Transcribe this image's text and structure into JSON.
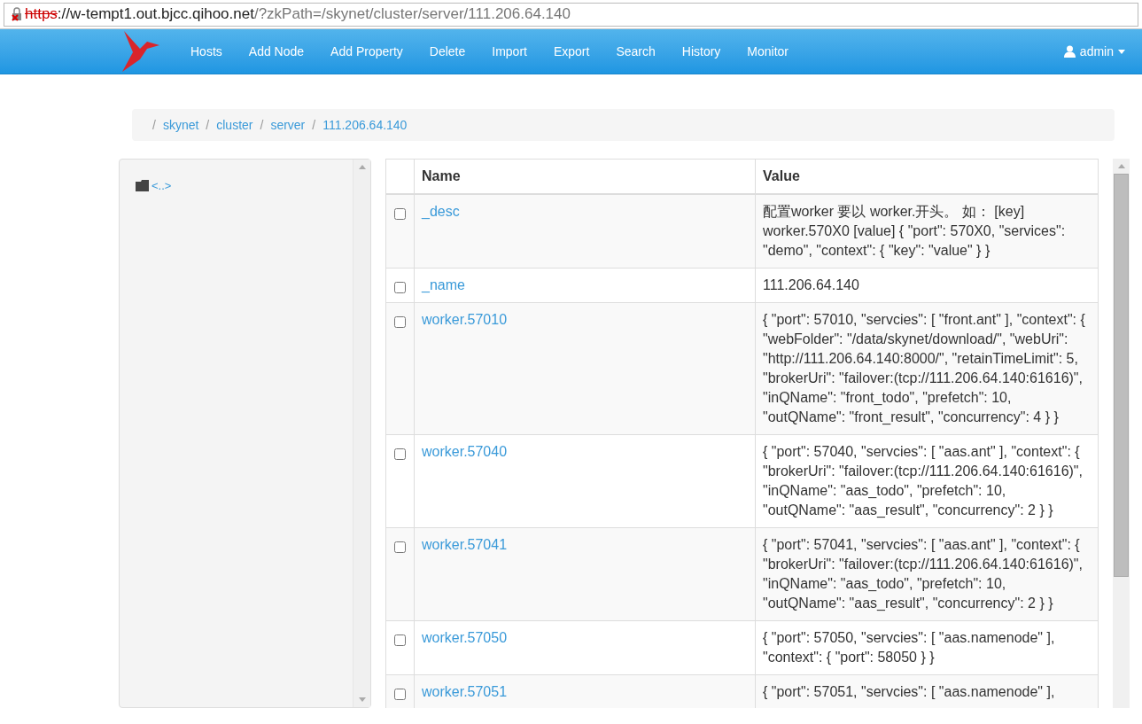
{
  "address_bar": {
    "scheme": "https",
    "host": "://w-tempt1.out.bjcc.qihoo.net",
    "path": "/?zkPath=/skynet/cluster/server/111.206.64.140"
  },
  "navbar": {
    "items": [
      "Hosts",
      "Add Node",
      "Add Property",
      "Delete",
      "Import",
      "Export",
      "Search",
      "History",
      "Monitor"
    ],
    "user": "admin"
  },
  "breadcrumb": [
    {
      "separator": "/",
      "label": "skynet"
    },
    {
      "separator": "/",
      "label": "cluster"
    },
    {
      "separator": "/",
      "label": "server"
    },
    {
      "separator": "/",
      "label": "111.206.64.140"
    }
  ],
  "tree": {
    "items": [
      "<..>"
    ]
  },
  "table": {
    "columns": [
      "Name",
      "Value"
    ],
    "rows": [
      {
        "name": "_desc",
        "value": "配置worker 要以 worker.开头。 如： [key] worker.570X0 [value] { \"port\": 570X0, \"services\": \"demo\", \"context\": { \"key\": \"value\" } }",
        "checked": false
      },
      {
        "name": "_name",
        "value": "111.206.64.140",
        "checked": false
      },
      {
        "name": "worker.57010",
        "value": "{ \"port\": 57010, \"servcies\": [ \"front.ant\" ], \"context\": { \"webFolder\": \"/data/skynet/download/\", \"webUri\": \"http://111.206.64.140:8000/\", \"retainTimeLimit\": 5, \"brokerUri\": \"failover:(tcp://111.206.64.140:61616)\", \"inQName\": \"front_todo\", \"prefetch\": 10, \"outQName\": \"front_result\", \"concurrency\": 4 } }",
        "checked": false
      },
      {
        "name": "worker.57040",
        "value": "{ \"port\": 57040, \"servcies\": [ \"aas.ant\" ], \"context\": { \"brokerUri\": \"failover:(tcp://111.206.64.140:61616)\", \"inQName\": \"aas_todo\", \"prefetch\": 10, \"outQName\": \"aas_result\", \"concurrency\": 2 } }",
        "checked": false
      },
      {
        "name": "worker.57041",
        "value": "{ \"port\": 57041, \"servcies\": [ \"aas.ant\" ], \"context\": { \"brokerUri\": \"failover:(tcp://111.206.64.140:61616)\", \"inQName\": \"aas_todo\", \"prefetch\": 10, \"outQName\": \"aas_result\", \"concurrency\": 2 } }",
        "checked": false
      },
      {
        "name": "worker.57050",
        "value": "{ \"port\": 57050, \"servcies\": [ \"aas.namenode\" ], \"context\": { \"port\": 58050 } }",
        "checked": false
      },
      {
        "name": "worker.57051",
        "value": "{ \"port\": 57051, \"servcies\": [ \"aas.namenode\" ],",
        "checked": false
      }
    ]
  }
}
